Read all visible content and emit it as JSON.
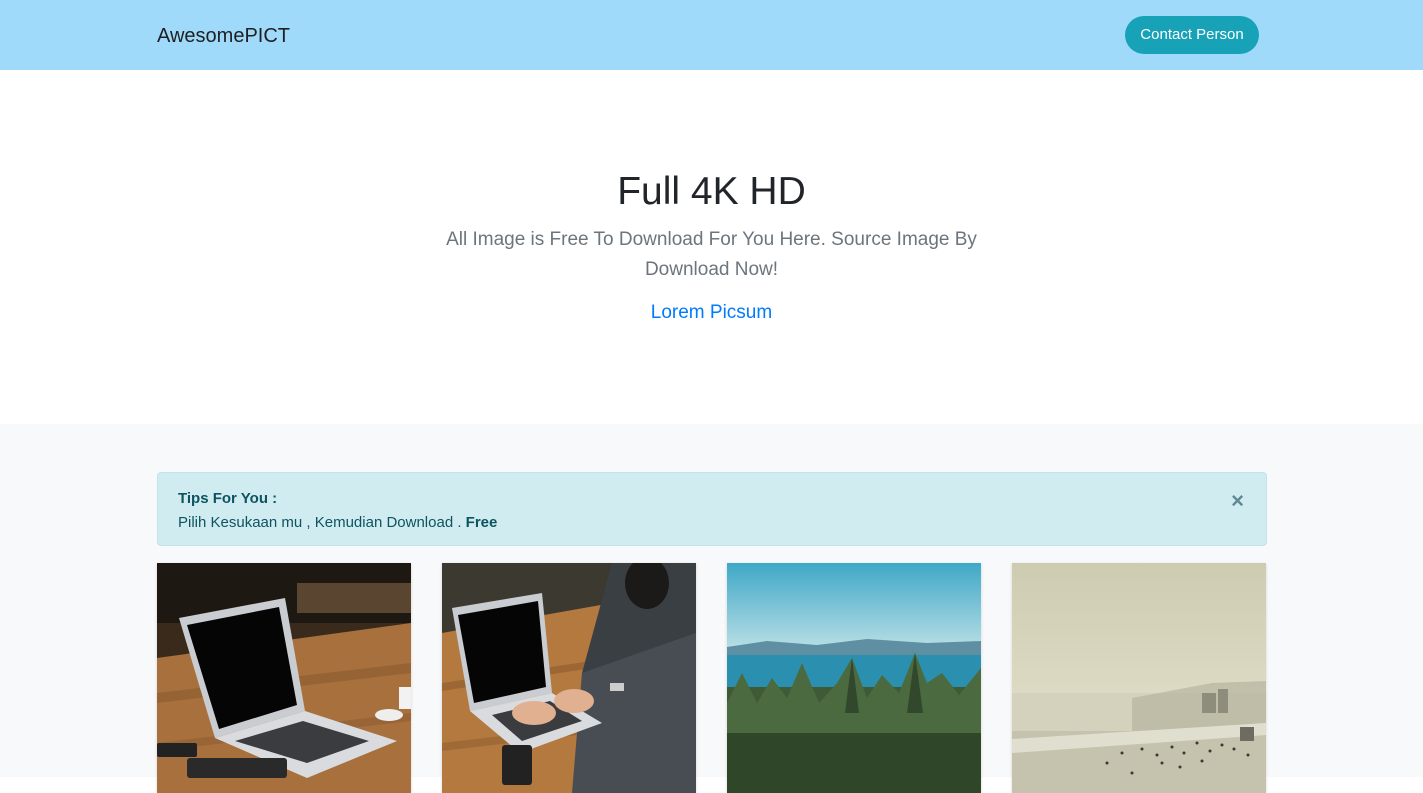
{
  "navbar": {
    "brand": "AwesomePICT",
    "contact_label": "Contact Person"
  },
  "hero": {
    "title": "Full 4K HD",
    "lead": "All Image is Free To Download For You Here. Source Image By Download Now!",
    "link_label": "Lorem Picsum"
  },
  "alert": {
    "heading": "Tips For You :",
    "text": "Pilih Kesukaan mu , Kemudian Download .",
    "emphasis": "Free",
    "close_glyph": "×"
  },
  "gallery": {
    "cards": [
      {
        "subject": "laptop on wooden desk"
      },
      {
        "subject": "person typing on laptop"
      },
      {
        "subject": "pine forest by the sea"
      },
      {
        "subject": "foggy beach with people"
      }
    ]
  },
  "colors": {
    "navbar_bg": "#a0dafa",
    "button_bg": "#17a2b8",
    "link": "#007bff",
    "alert_bg": "#d1ecf1",
    "alert_text": "#0c5460"
  }
}
